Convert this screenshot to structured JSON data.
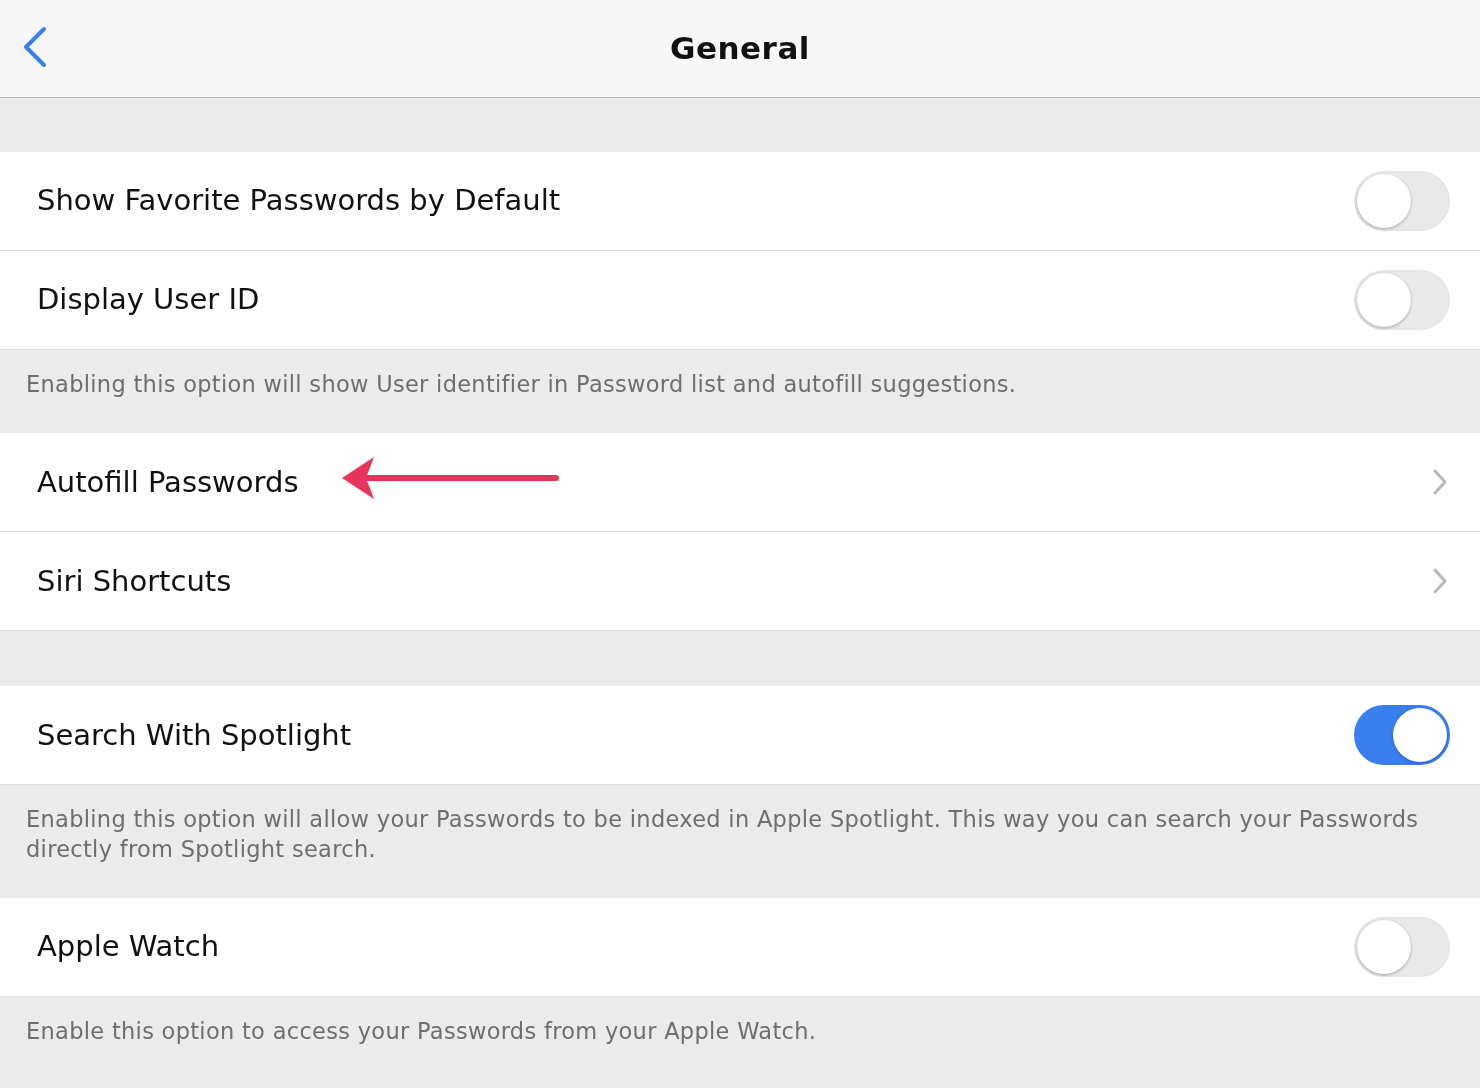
{
  "header": {
    "title": "General"
  },
  "groups": [
    {
      "rows": [
        {
          "kind": "toggle",
          "label": "Show Favorite Passwords by Default",
          "on": false
        },
        {
          "kind": "toggle",
          "label": "Display User ID",
          "on": false
        }
      ],
      "footer": "Enabling this option will show User identifier in Password list and autofill suggestions."
    },
    {
      "rows": [
        {
          "kind": "link",
          "label": "Autofill Passwords",
          "annotated": true
        },
        {
          "kind": "link",
          "label": "Siri Shortcuts",
          "annotated": false
        }
      ]
    },
    {
      "rows": [
        {
          "kind": "toggle",
          "label": "Search With Spotlight",
          "on": true
        }
      ],
      "footer": "Enabling this option will allow your Passwords to be indexed in Apple Spotlight. This way you can search your Passwords directly from Spotlight search."
    },
    {
      "rows": [
        {
          "kind": "toggle",
          "label": "Apple Watch",
          "on": false
        }
      ],
      "footer": "Enable this option to access your Passwords from your Apple Watch."
    }
  ]
}
